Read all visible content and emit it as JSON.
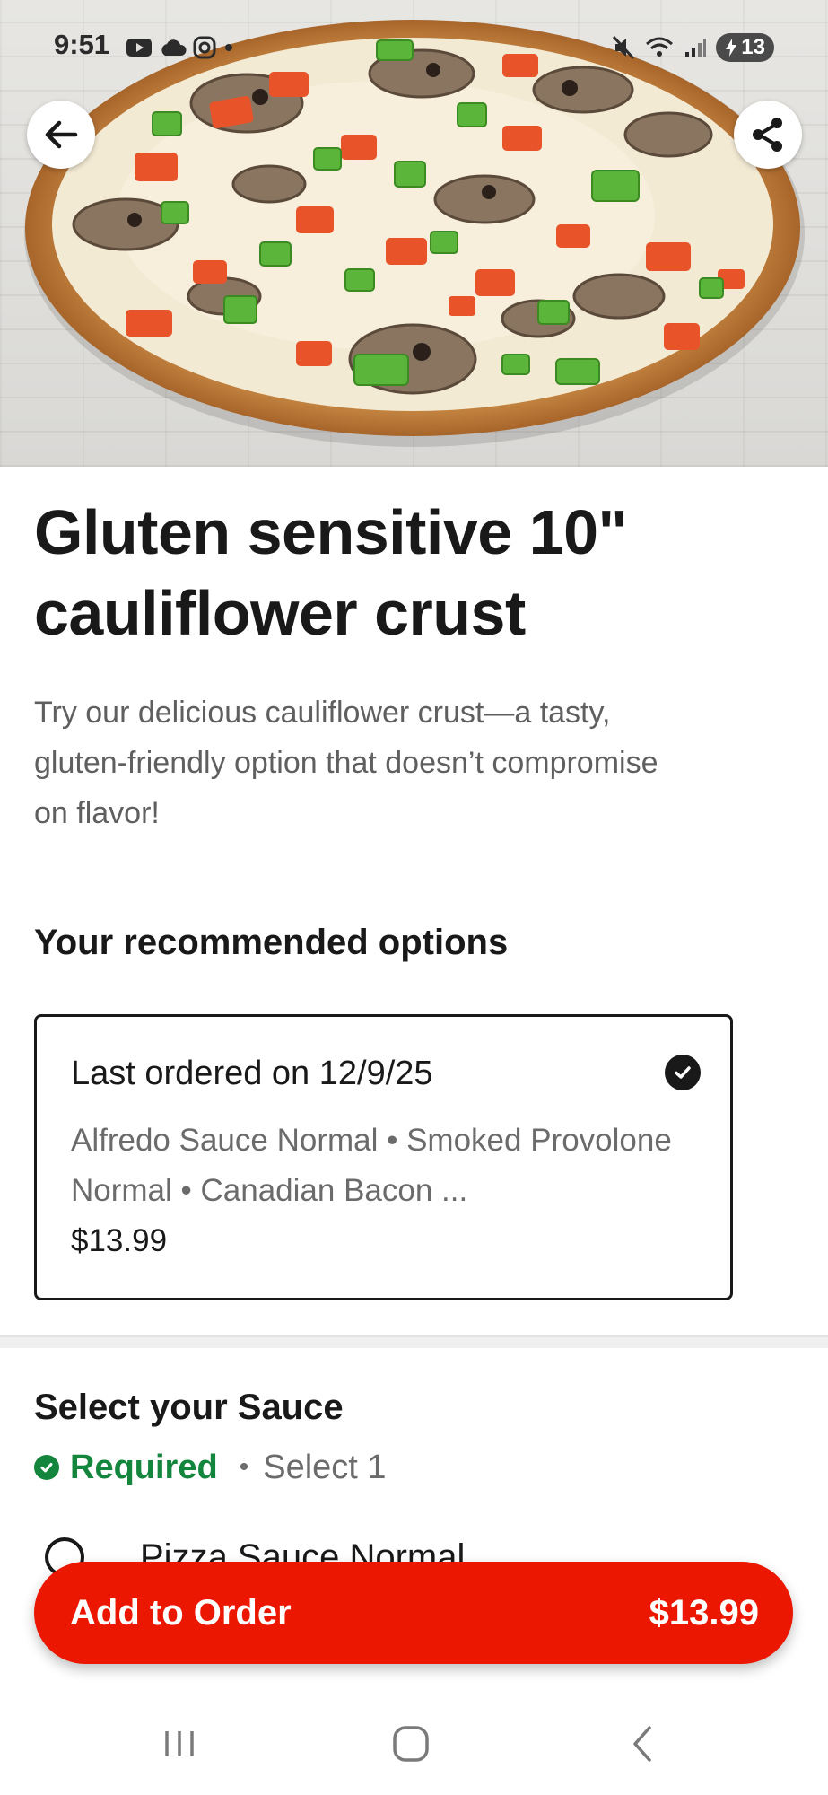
{
  "status_bar": {
    "time": "9:51",
    "battery": "13",
    "icons_left": [
      "youtube-icon",
      "cloud-icon",
      "camera-icon",
      "dot-icon"
    ],
    "icons_right": [
      "mute-icon",
      "wifi-icon",
      "signal-icon",
      "battery-icon"
    ]
  },
  "hero": {
    "image": "pizza-photo",
    "back_icon": "arrow-left-icon",
    "share_icon": "share-icon"
  },
  "item": {
    "title": "Gluten sensitive 10\" cauliflower crust",
    "description": "Try our delicious cauliflower crust—a tasty, gluten-friendly option that doesn’t compromise on flavor!"
  },
  "recommended": {
    "heading": "Your recommended options",
    "option": {
      "label": "Last ordered on 12/9/25",
      "details": "Alfredo Sauce Normal • Smoked Provolone Normal • Canadian Bacon ...",
      "price": "$13.99",
      "selected": true
    }
  },
  "sauce": {
    "heading": "Select your Sauce",
    "required_label": "Required",
    "separator": "•",
    "select_hint": "Select 1",
    "options": [
      {
        "label": "Pizza Sauce Normal",
        "selected": false
      }
    ]
  },
  "cta": {
    "label": "Add to Order",
    "price": "$13.99"
  },
  "nav": {
    "icons": [
      "recent-apps-icon",
      "home-icon",
      "back-nav-icon"
    ]
  },
  "colors": {
    "brand": "#eb1700",
    "required": "#14853c",
    "text": "#191919",
    "muted": "#6b6b6b"
  }
}
